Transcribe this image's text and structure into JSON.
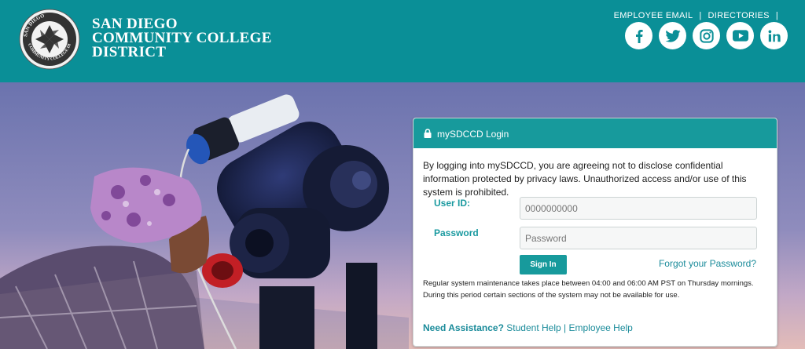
{
  "header": {
    "brand_lines": [
      "SAN DIEGO",
      "COMMUNITY COLLEGE",
      "DISTRICT"
    ],
    "seal_text": "SAN DIEGO COMMUNITY COLLEGE DISTRICT",
    "links": [
      "EMPLOYEE EMAIL",
      "DIRECTORIES"
    ],
    "separator": "|",
    "social": [
      {
        "icon": "facebook-icon",
        "glyph": "f"
      },
      {
        "icon": "twitter-icon",
        "glyph": "t"
      },
      {
        "icon": "instagram-icon",
        "glyph": "◎"
      },
      {
        "icon": "youtube-icon",
        "glyph": "▶"
      },
      {
        "icon": "linkedin-icon",
        "glyph": "in"
      }
    ]
  },
  "login": {
    "title": "mySDCCD Login",
    "notice": "By logging into mySDCCD, you are agreeing not to disclose confidential information protected by privacy laws. Unauthorized access and/or use of this system is prohibited.",
    "userid_label": "User ID:",
    "userid_placeholder": "0000000000",
    "password_label": "Password",
    "password_placeholder": "Password",
    "signin_label": "Sign In",
    "forgot_label": "Forgot your Password?",
    "maintenance": "Regular system maintenance takes place between 04:00 and 06:00 AM PST on Thursday mornings. During this period certain sections of the system may not be available for use.",
    "assist_label": "Need Assistance?",
    "student_help": "Student Help",
    "help_separator": "|",
    "employee_help": "Employee Help"
  },
  "colors": {
    "header_teal": "#0a8f97",
    "card_teal": "#179a9c",
    "link_teal": "#1a8b9a"
  }
}
